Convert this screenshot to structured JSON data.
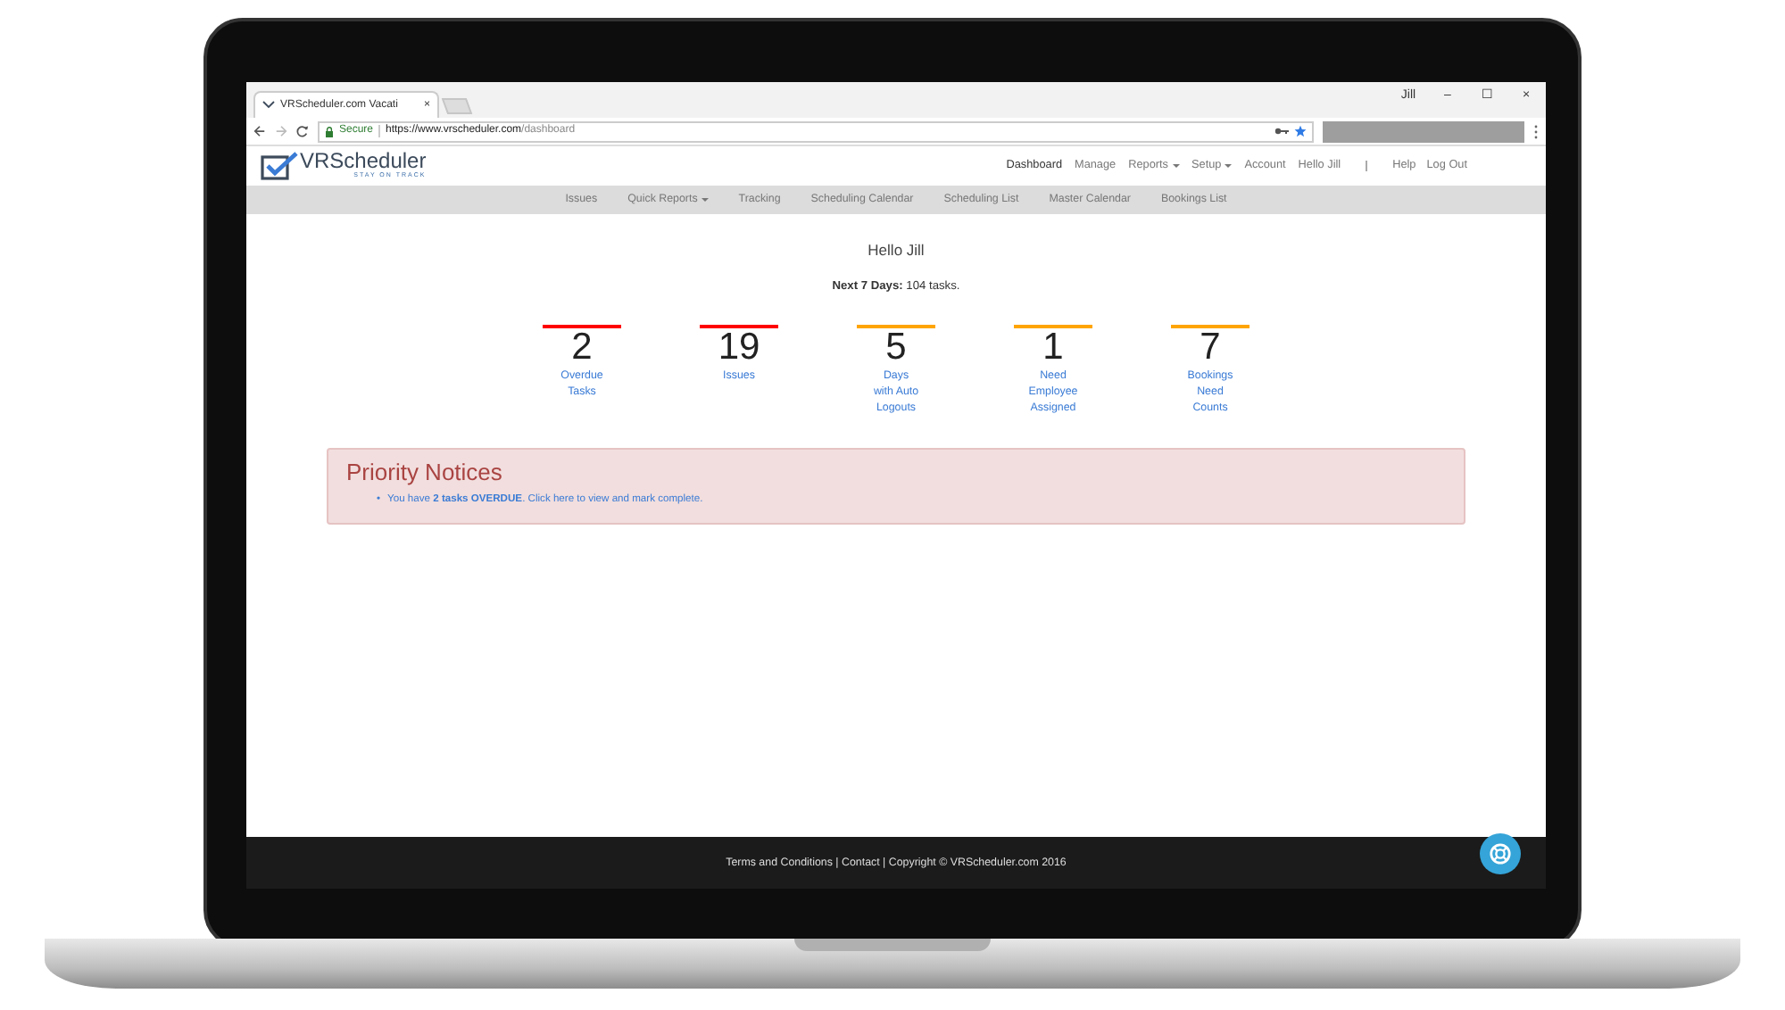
{
  "browser": {
    "tab_title": "VRScheduler.com Vacati",
    "tab_close": "×",
    "user": "Jill",
    "window_controls": [
      "–",
      "☐",
      "×"
    ],
    "secure_label": "Secure",
    "url_host": "https://www.vrscheduler.com",
    "url_path": "/dashboard"
  },
  "logo": {
    "name": "VRScheduler",
    "tagline": "STAY ON TRACK"
  },
  "nav": [
    {
      "label": "Dashboard",
      "selected": true,
      "dropdown": false
    },
    {
      "label": "Manage",
      "selected": false,
      "dropdown": false
    },
    {
      "label": "Reports",
      "selected": false,
      "dropdown": true
    },
    {
      "label": "Setup",
      "selected": false,
      "dropdown": true
    },
    {
      "label": "Account",
      "selected": false,
      "dropdown": false
    },
    {
      "label": "Hello Jill",
      "selected": false,
      "dropdown": false
    }
  ],
  "nav_right": [
    "Help",
    "Log Out"
  ],
  "subnav": [
    {
      "label": "Issues",
      "dropdown": false
    },
    {
      "label": "Quick Reports",
      "dropdown": true
    },
    {
      "label": "Tracking",
      "dropdown": false
    },
    {
      "label": "Scheduling Calendar",
      "dropdown": false
    },
    {
      "label": "Scheduling List",
      "dropdown": false
    },
    {
      "label": "Master Calendar",
      "dropdown": false
    },
    {
      "label": "Bookings List",
      "dropdown": false
    }
  ],
  "greeting": "Hello Jill",
  "summary": "**Next 7 Days:** 104 tasks.",
  "stats": [
    {
      "value": "2",
      "lines": [
        "Overdue",
        "Tasks"
      ],
      "color": "#ff0000"
    },
    {
      "value": "19",
      "lines": [
        "Issues"
      ],
      "color": "#ff0000"
    },
    {
      "value": "5",
      "lines": [
        "Days",
        "with Auto",
        "Logouts"
      ],
      "color": "#ffa500"
    },
    {
      "value": "1",
      "lines": [
        "Need",
        "Employee",
        "Assigned"
      ],
      "color": "#ffa500"
    },
    {
      "value": "7",
      "lines": [
        "Bookings",
        "Need",
        "Counts"
      ],
      "color": "#ffa500"
    }
  ],
  "notices": {
    "title": "Priority Notices",
    "bullet": "•",
    "items": [
      "You have **2 tasks OVERDUE**. Click here to view and mark complete."
    ]
  },
  "footer": "Terms and Conditions | Contact | Copyright © VRScheduler.com 2016"
}
